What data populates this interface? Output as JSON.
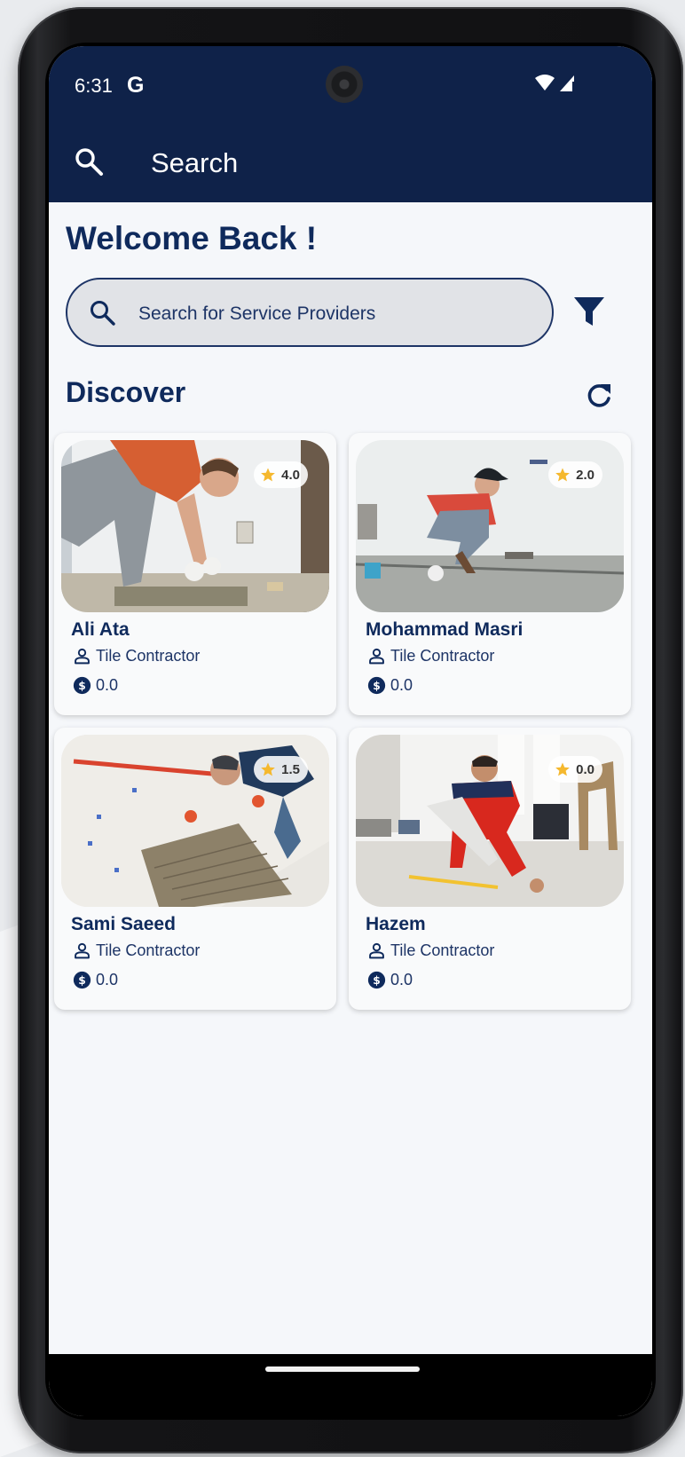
{
  "status_bar": {
    "time": "6:31",
    "carrier_glyph": "G",
    "icons": [
      "wifi-icon",
      "signal-icon"
    ]
  },
  "app_bar": {
    "icon": "search-icon",
    "title": "Search"
  },
  "welcome": "Welcome Back !",
  "search": {
    "placeholder": "Search for Service Providers",
    "value": ""
  },
  "filter_icon": "filter-icon",
  "discover": {
    "title": "Discover",
    "refresh_icon": "refresh-icon"
  },
  "providers": [
    {
      "name": "Ali Ata",
      "role": "Tile Contractor",
      "price": "0.0",
      "rating": "4.0"
    },
    {
      "name": "Mohammad Masri",
      "role": "Tile Contractor",
      "price": "0.0",
      "rating": "2.0"
    },
    {
      "name": "Sami Saeed",
      "role": "Tile Contractor",
      "price": "0.0",
      "rating": "1.5"
    },
    {
      "name": "Hazem",
      "role": "Tile Contractor",
      "price": "0.0",
      "rating": "0.0"
    }
  ],
  "colors": {
    "primary": "#0f2249",
    "text_primary": "#0f2a5c",
    "star": "#f5b82e",
    "background": "#f5f7fa"
  }
}
